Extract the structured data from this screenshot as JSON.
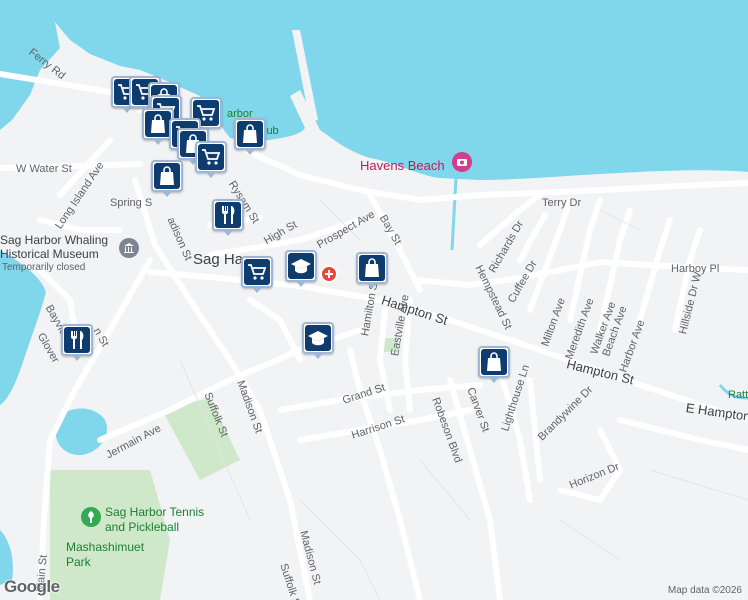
{
  "map": {
    "colors": {
      "water": "#80d6ea",
      "land": "#f2f3f5",
      "road": "#ffffff",
      "park": "#cfe8c9",
      "pin_fill": "#0f3c6e",
      "pin_border": "#9fb6d6"
    },
    "places": {
      "town": "Sag Harbor",
      "museum_line1": "Sag Harbor Whaling",
      "museum_line2": "Historical Museum",
      "museum_status": "Temporarily closed",
      "beach": "Havens Beach",
      "park1_line1": "Sag Harbor Tennis",
      "park1_line2": "and Pickleball",
      "park2_line1": "Mashashimuet",
      "park2_line2": "Park",
      "club_frag1": "arbor",
      "club_frag2": "lub",
      "partial_sag": "Sag Ha",
      "partial_rt": "Rattl"
    },
    "streets": {
      "ferry": "Ferry Rd",
      "wwater": "W Water St",
      "longisland": "Long Island Ave",
      "spring": "Spring S",
      "madison_upper": "adison St",
      "madison_mid": "Madison St",
      "madison_low": "Madison St",
      "high": "High St",
      "prospect": "Prospect Ave",
      "bay": "Bay St",
      "rysam": "Rysam St",
      "hampton": "Hampton St",
      "hampton2": "Hampton St",
      "ehampton": "E Hampton",
      "hamilton": "Hamilton St",
      "eastville": "Eastville Ave",
      "hempstead": "Hempstead St",
      "richards": "Richards Dr",
      "cuffee": "Cuffee Dr",
      "milton": "Milton Ave",
      "meredith": "Meredith Ave",
      "walker": "Walker Ave",
      "beach": "Beach Ave",
      "harbor": "Harbor Ave",
      "hillside": "Hillside Dr W",
      "harboy": "Harboy Pl",
      "terry": "Terry Dr",
      "grand": "Grand St",
      "harrison": "Harrison St",
      "robeson": "Robeson Blvd",
      "carver": "Carver St",
      "lighthouse": "Lighthouse Ln",
      "brandywine": "Brandywine Dr",
      "horizon": "Horizon Dr",
      "jermain": "Jermain Ave",
      "suffolk": "Suffolk St",
      "suffolk2": "Suffolk St",
      "bayview": "Bayview",
      "glover": "Glover",
      "main": "Main St",
      "nst": "n St"
    },
    "footer": {
      "logo": "Google",
      "data": "Map data ©2026"
    },
    "pins": [
      {
        "icon": "cart-icon"
      },
      {
        "icon": "cart-icon"
      },
      {
        "icon": "bag-icon"
      },
      {
        "icon": "cart-icon"
      },
      {
        "icon": "cart-icon"
      },
      {
        "icon": "bag-icon"
      },
      {
        "icon": "cart-icon"
      },
      {
        "icon": "bag-icon"
      },
      {
        "icon": "bag-icon"
      },
      {
        "icon": "cart-icon"
      },
      {
        "icon": "bag-icon"
      },
      {
        "icon": "fork-knife-icon"
      },
      {
        "icon": "cart-icon"
      },
      {
        "icon": "school-icon"
      },
      {
        "icon": "bag-icon"
      },
      {
        "icon": "fork-knife-icon"
      },
      {
        "icon": "school-icon"
      },
      {
        "icon": "bag-icon"
      }
    ]
  }
}
